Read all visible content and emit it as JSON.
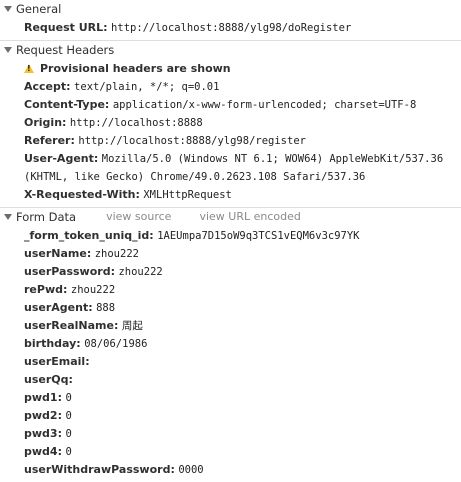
{
  "general": {
    "title": "General",
    "rows": [
      {
        "key": "Request URL:",
        "value": "http://localhost:8888/ylg98/doRegister"
      }
    ]
  },
  "request_headers": {
    "title": "Request Headers",
    "warning": "Provisional headers are shown",
    "rows": [
      {
        "key": "Accept:",
        "value": "text/plain, */*; q=0.01"
      },
      {
        "key": "Content-Type:",
        "value": "application/x-www-form-urlencoded; charset=UTF-8"
      },
      {
        "key": "Origin:",
        "value": "http://localhost:8888"
      },
      {
        "key": "Referer:",
        "value": "http://localhost:8888/ylg98/register"
      },
      {
        "key": "User-Agent:",
        "value": "Mozilla/5.0 (Windows NT 6.1; WOW64) AppleWebKit/537.36 (KHTML, like Gecko) Chrome/49.0.2623.108 Safari/537.36"
      },
      {
        "key": "X-Requested-With:",
        "value": "XMLHttpRequest"
      }
    ]
  },
  "form_data": {
    "title": "Form Data",
    "view_source": "view source",
    "view_url_encoded": "view URL encoded",
    "rows": [
      {
        "key": "_form_token_uniq_id:",
        "value": "1AEUmpa7D15oW9q3TCS1vEQM6v3c97YK"
      },
      {
        "key": "userName:",
        "value": "zhou222"
      },
      {
        "key": "userPassword:",
        "value": "zhou222"
      },
      {
        "key": "rePwd:",
        "value": "zhou222"
      },
      {
        "key": "userAgent:",
        "value": "888"
      },
      {
        "key": "userRealName:",
        "value": "周起"
      },
      {
        "key": "birthday:",
        "value": "08/06/1986"
      },
      {
        "key": "userEmail:",
        "value": ""
      },
      {
        "key": "userQq:",
        "value": ""
      },
      {
        "key": "pwd1:",
        "value": "0"
      },
      {
        "key": "pwd2:",
        "value": "0"
      },
      {
        "key": "pwd3:",
        "value": "0"
      },
      {
        "key": "pwd4:",
        "value": "0"
      },
      {
        "key": "userWithdrawPassword:",
        "value": "0000"
      }
    ]
  }
}
